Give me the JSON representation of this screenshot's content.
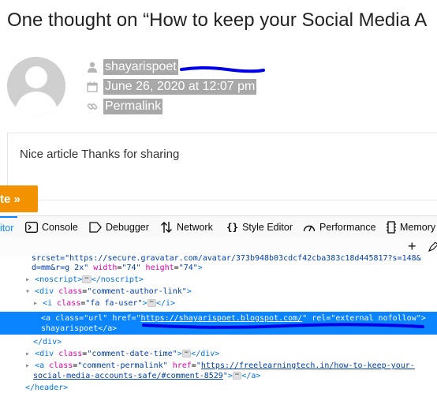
{
  "page": {
    "title": "One thought on “How to keep your Social Media A"
  },
  "comment": {
    "author": "shayarispoet",
    "date": "June 26, 2020 at 12:07 pm",
    "permalink": "Permalink",
    "text": "Nice article Thanks for sharing",
    "icons": [
      "user-icon",
      "calendar-icon",
      "link-icon"
    ]
  },
  "floating": {
    "button_label": "te »",
    "color": "#f39200"
  },
  "devtools": {
    "tabs": [
      {
        "label": "itor",
        "icon": ""
      },
      {
        "label": "Console",
        "icon": "console-icon"
      },
      {
        "label": "Debugger",
        "icon": "debugger-icon"
      },
      {
        "label": "Network",
        "icon": "network-icon"
      },
      {
        "label": "Style Editor",
        "icon": "style-editor-icon"
      },
      {
        "label": "Performance",
        "icon": "performance-icon"
      },
      {
        "label": "Memory",
        "icon": "memory-icon"
      }
    ],
    "add_label": "+",
    "accent": "#0a84ff",
    "tree": {
      "l1": "srcset=\"https://secure.gravatar.com/avatar/373b948b03cdcf42cba383c18d445817?s=148&",
      "l2_a": "d=mm&r=g 2x\"",
      "l2_b": "width",
      "l2_c": "\"74\"",
      "l2_d": "height",
      "l2_e": "\"74\"",
      "l3_open": "<noscript>",
      "l3_close": "</noscript>",
      "l4_tag": "<div",
      "l4_attr": "class",
      "l4_val": "\"comment-author-link\"",
      "l5_tag": "<i",
      "l5_attr": "class",
      "l5_val": "\"fa fa-user\"",
      "l5_close": "</i>",
      "l6_tag": "<a",
      "l6_attr1": "class",
      "l6_val1": "\"url\"",
      "l6_attr2": "href",
      "l6_href": "https://shayarispoet.blogspot.com/",
      "l6_attr3": "rel",
      "l6_val3": "\"external nofollow\"",
      "l7_text": "shayarispoet",
      "l7_close": "</a>",
      "l8": "</div>",
      "l9_tag": "<div",
      "l9_attr": "class",
      "l9_val": "\"comment-date-time\"",
      "l9_close": "</div>",
      "l10_tag": "<a",
      "l10_attr1": "class",
      "l10_val1": "\"comment-permalink\"",
      "l10_attr2": "href",
      "l10_href": "https://freelearningtech.in/how-to-keep-your-",
      "l11_href": "social-media-accounts-safe/#comment-8529",
      "l11_close": "</a>",
      "l12": "</header>",
      "ellipsis": "⋯"
    }
  }
}
